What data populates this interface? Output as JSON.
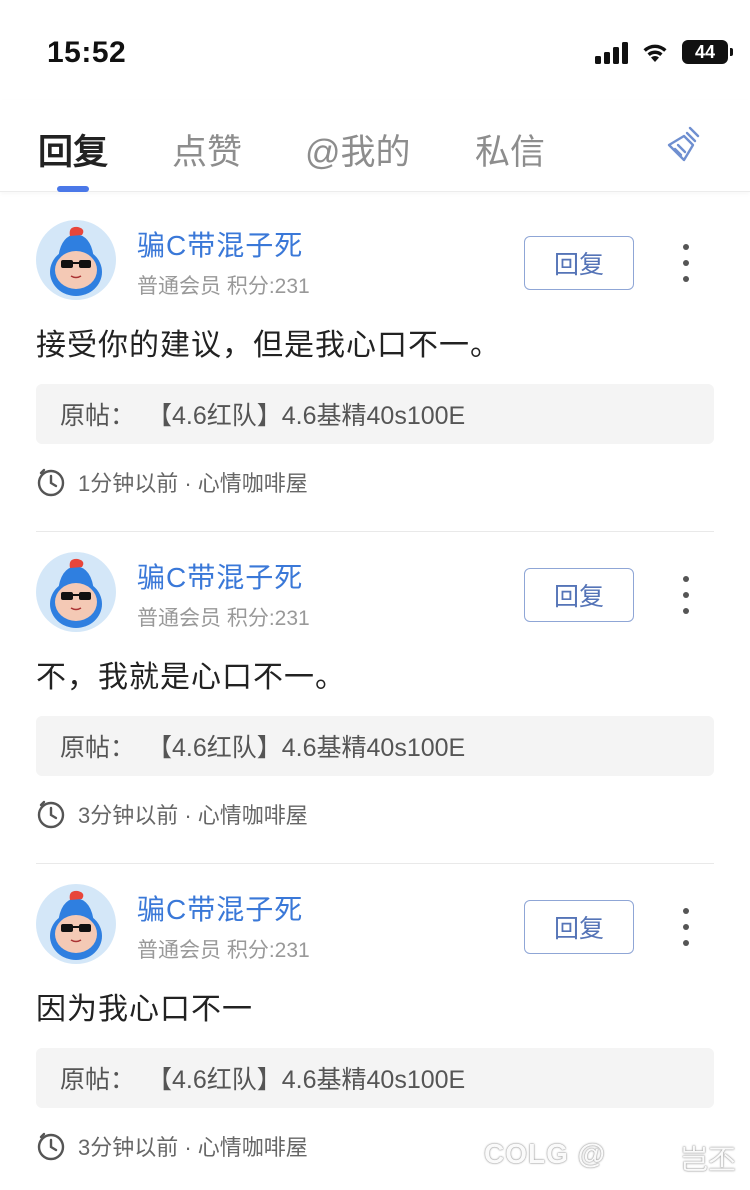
{
  "status_bar": {
    "time": "15:52",
    "battery": "44"
  },
  "tabs": [
    {
      "label": "回复",
      "active": true
    },
    {
      "label": "点赞",
      "active": false
    },
    {
      "label": "@我的",
      "active": false
    },
    {
      "label": "私信",
      "active": false
    }
  ],
  "accent_color": "#4a78e8",
  "username_color": "#3a78d8",
  "posts": [
    {
      "username": "骗C带混子死",
      "meta": "普通会员 积分:231",
      "reply_label": "回复",
      "content": "接受你的建议，但是我心口不一。",
      "origin_label": "原帖：",
      "origin_title": "【4.6红队】4.6基精40s100E",
      "footer": "1分钟以前 · 心情咖啡屋"
    },
    {
      "username": "骗C带混子死",
      "meta": "普通会员 积分:231",
      "reply_label": "回复",
      "content": "不，我就是心口不一。",
      "origin_label": "原帖：",
      "origin_title": "【4.6红队】4.6基精40s100E",
      "footer": "3分钟以前 · 心情咖啡屋"
    },
    {
      "username": "骗C带混子死",
      "meta": "普通会员 积分:231",
      "reply_label": "回复",
      "content": "因为我心口不一",
      "origin_label": "原帖：",
      "origin_title": "【4.6红队】4.6基精40s100E",
      "footer": "3分钟以前 · 心情咖啡屋"
    }
  ],
  "watermark": "COLG @",
  "watermark_right": "岂丕"
}
